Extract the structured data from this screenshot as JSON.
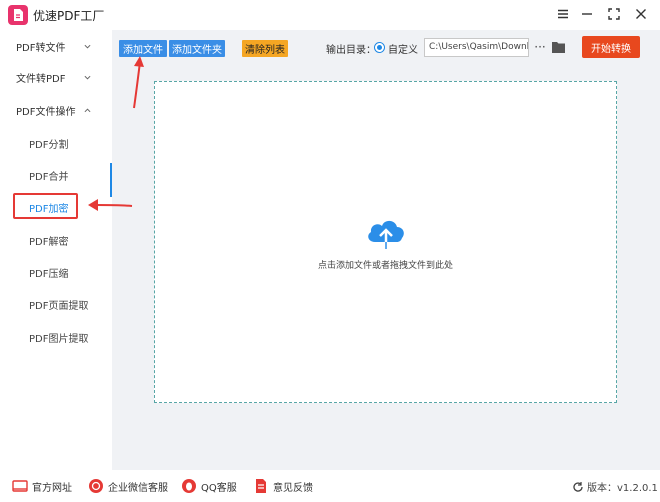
{
  "app": {
    "title": "优速PDF工厂"
  },
  "sidebar": {
    "groups": [
      {
        "label": "PDF转文件"
      },
      {
        "label": "文件转PDF"
      },
      {
        "label": "PDF文件操作"
      }
    ],
    "items": [
      {
        "label": "PDF分割"
      },
      {
        "label": "PDF合并"
      },
      {
        "label": "PDF加密"
      },
      {
        "label": "PDF解密"
      },
      {
        "label": "PDF压缩"
      },
      {
        "label": "PDF页面提取"
      },
      {
        "label": "PDF图片提取"
      }
    ]
  },
  "toolbar": {
    "add_file": "添加文件",
    "add_folder": "添加文件夹",
    "clear_list": "清除列表",
    "output_label": "输出目录：",
    "custom_label": "自定义",
    "path_value": "C:\\Users\\Qasim\\Downlo",
    "more": "···",
    "start": "开始转换"
  },
  "drop": {
    "hint": "点击添加文件或者拖拽文件到此处"
  },
  "footer": {
    "website": "官方网址",
    "wechat": "企业微信客服",
    "qq": "QQ客服",
    "feedback": "意见反馈",
    "version": "版本：v1.2.0.1"
  },
  "colors": {
    "accent": "#1e88e5",
    "start_button": "#e8481e",
    "clear_button": "#f5a623",
    "annotation": "#e53935"
  }
}
